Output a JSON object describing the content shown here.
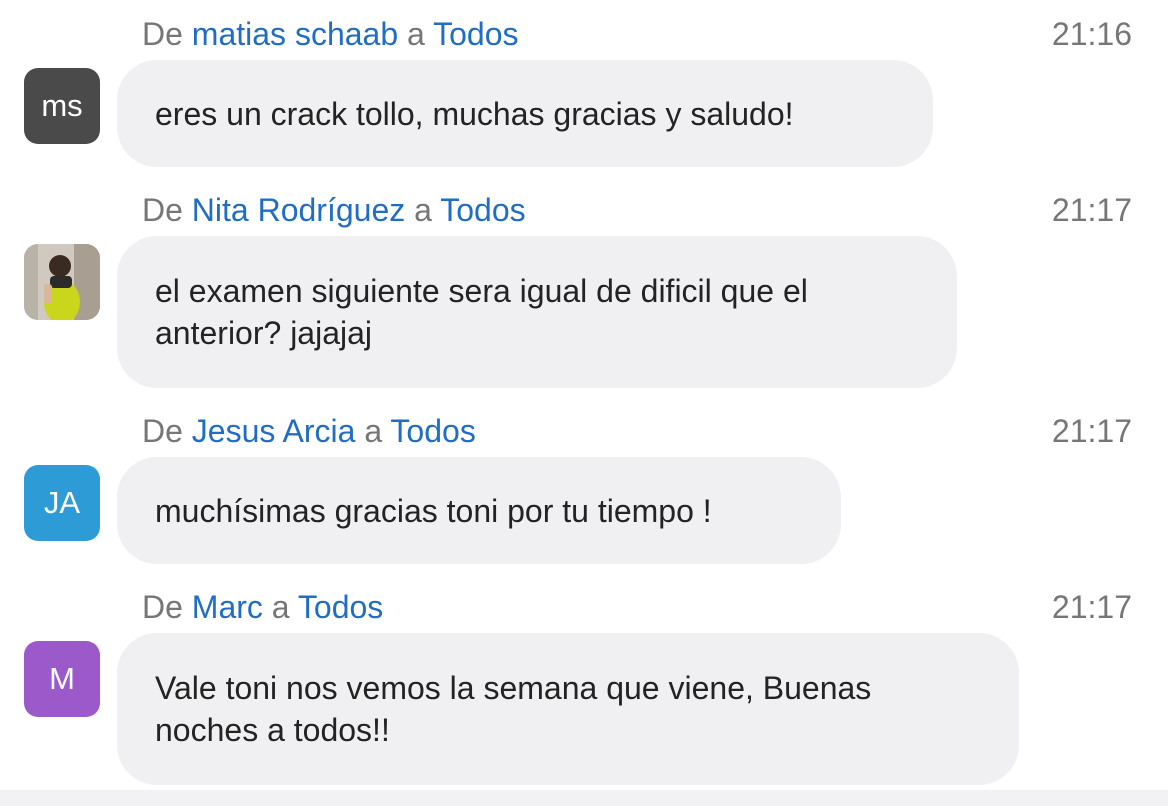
{
  "labels": {
    "from": "De",
    "to": "a"
  },
  "colors": {
    "name": "#1f6dc4",
    "muted": "#767676",
    "bubble": "#f0f0f3"
  },
  "messages": [
    {
      "sender": "matias schaab",
      "recipient": "Todos",
      "time": "21:16",
      "avatar_text": "ms",
      "avatar_color": "#4a4a4a",
      "text": "eres un crack tollo, muchas gracias y saludo!"
    },
    {
      "sender": "Nita Rodríguez",
      "recipient": "Todos",
      "time": "21:17",
      "avatar_text": "",
      "avatar_type": "photo",
      "text": "el examen siguiente sera igual de dificil que el anterior? jajajaj"
    },
    {
      "sender": "Jesus Arcia",
      "recipient": "Todos",
      "time": "21:17",
      "avatar_text": "JA",
      "avatar_color": "#2c9bd6",
      "text": "muchísimas gracias toni por tu tiempo !"
    },
    {
      "sender": "Marc",
      "recipient": "Todos",
      "time": "21:17",
      "avatar_text": "M",
      "avatar_color": "#9b59c9",
      "text": "Vale toni nos vemos la semana que viene, Buenas noches a todos!!"
    }
  ]
}
